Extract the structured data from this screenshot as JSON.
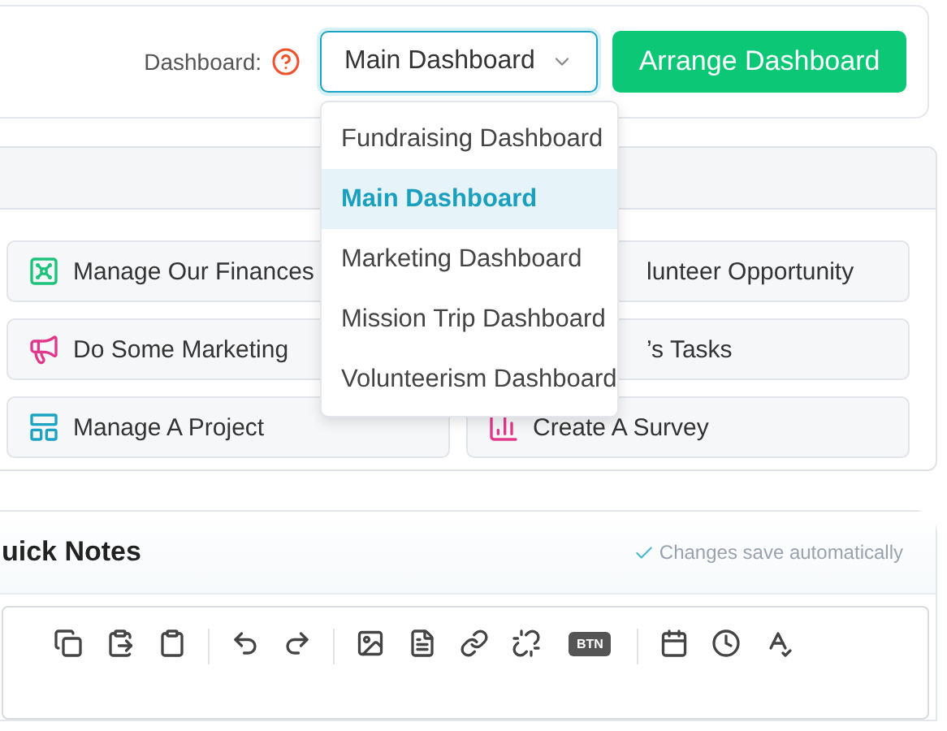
{
  "header": {
    "label": "Dashboard:",
    "select": {
      "value": "Main Dashboard",
      "expanded": true,
      "options": [
        {
          "label": "Fundraising Dashboard",
          "selected": false
        },
        {
          "label": "Main Dashboard",
          "selected": true
        },
        {
          "label": "Marketing Dashboard",
          "selected": false
        },
        {
          "label": "Mission Trip Dashboard",
          "selected": false
        },
        {
          "label": "Volunteerism Dashboard",
          "selected": false
        }
      ]
    },
    "button": "Arrange Dashboard"
  },
  "quick_actions": [
    {
      "label": "Manage Our Finances",
      "kind": "plain"
    },
    {
      "label": "lunteer Opportunity",
      "kind": "covered"
    },
    {
      "label": "Do Some Marketing",
      "kind": "plain"
    },
    {
      "label": "’s Tasks",
      "kind": "covered"
    },
    {
      "label": "Manage A Project",
      "kind": "plain"
    },
    {
      "label": "Create A Survey",
      "kind": "plain"
    }
  ],
  "notes": {
    "title": "uick Notes",
    "status": "Changes save automatically",
    "toolbar_badge": "BTN"
  }
}
